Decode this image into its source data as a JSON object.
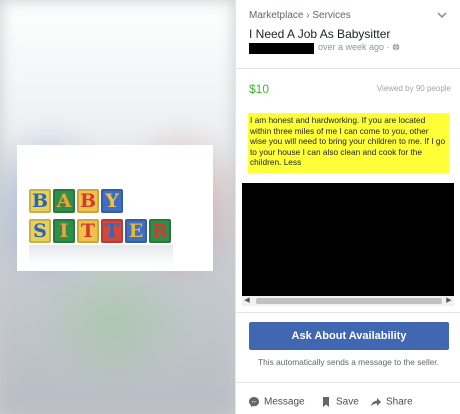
{
  "listing": {
    "breadcrumb": "Marketplace › Services",
    "title": "I Need A Job As Babysitter",
    "posted": "over a week ago · ",
    "globe_icon": "globe-icon",
    "price": "$10",
    "views": "Viewed by 90 people",
    "description": "I am honest and hardworking. If you are located within three miles of me I can come to you, other wise you will need to bring your children to me. If I go to your house I can also clean and cook for the children.",
    "less_link": "Less",
    "colors": {
      "accent": "#4267b2",
      "price": "#42b72a",
      "highlight": "#ffff37"
    }
  },
  "image": {
    "blocks_top": [
      "B",
      "A",
      "B",
      "Y"
    ],
    "blocks_bottom": [
      "S",
      "I",
      "T",
      "T",
      "E",
      "R"
    ]
  },
  "actions": {
    "ask_button": "Ask About Availability",
    "ask_note": "This automatically sends a message to the seller.",
    "message": "Message",
    "save": "Save",
    "share": "Share"
  }
}
